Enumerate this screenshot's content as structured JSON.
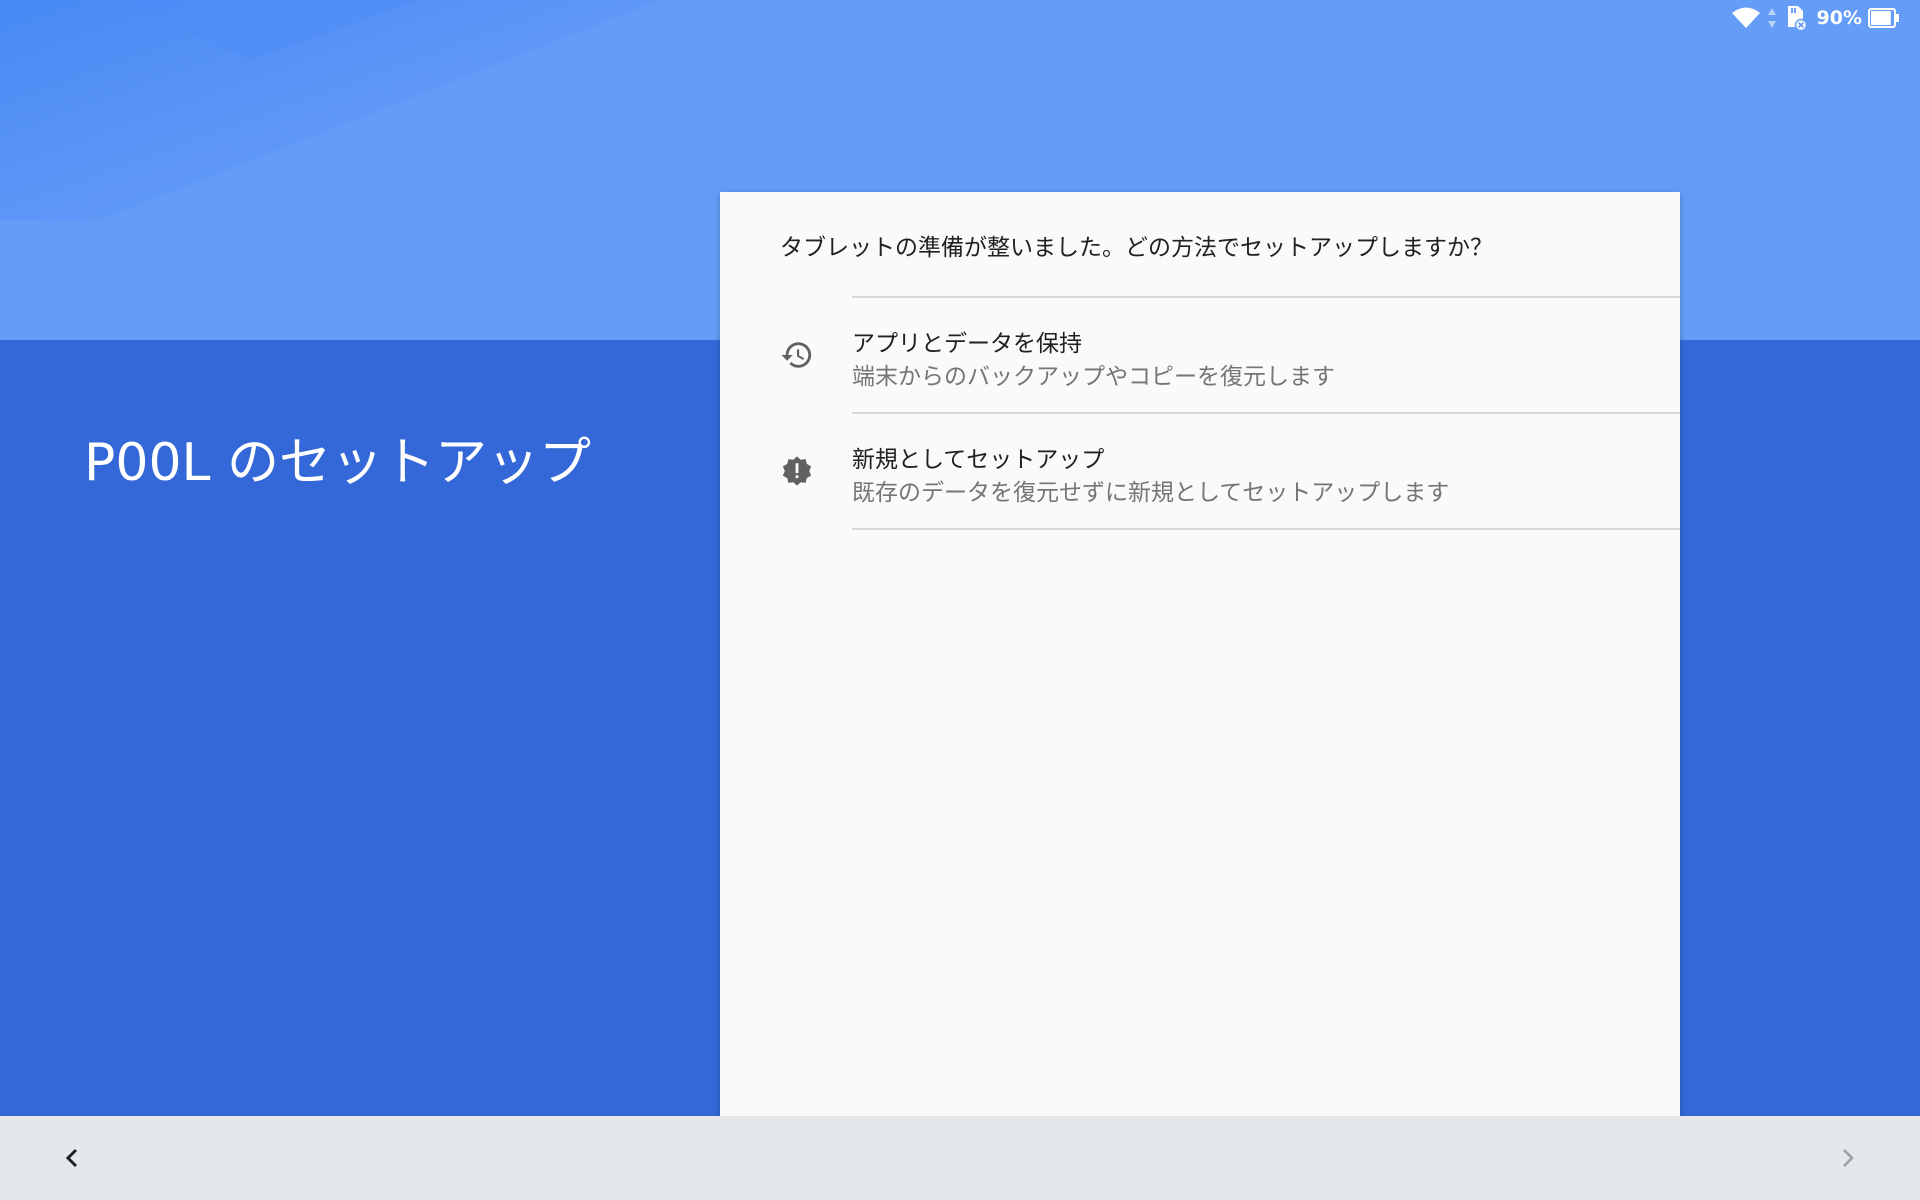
{
  "status_bar": {
    "battery_percent_label": "90%",
    "battery_level": 0.9,
    "icons": [
      "wifi-icon",
      "data-arrows-icon",
      "sd-card-icon",
      "battery-icon"
    ]
  },
  "setup": {
    "title": "P00L のセットアップ"
  },
  "card": {
    "question": "タブレットの準備が整いました。どの方法でセットアップしますか？",
    "options": [
      {
        "icon": "restore-icon",
        "title": "アプリとデータを保持",
        "subtitle": "端末からのバックアップやコピーを復元します"
      },
      {
        "icon": "new-badge-icon",
        "title": "新規としてセットアップ",
        "subtitle": "既存のデータを復元せずに新規としてセットアップします"
      }
    ]
  },
  "nav": {
    "back_icon": "chevron-left-icon",
    "next_icon": "chevron-right-icon"
  },
  "colors": {
    "top_band": "#649cf8",
    "lower_band": "#3468d8",
    "card": "#fafafa",
    "nav_bar": "#e5e8eb",
    "icon_gray": "#616161"
  }
}
